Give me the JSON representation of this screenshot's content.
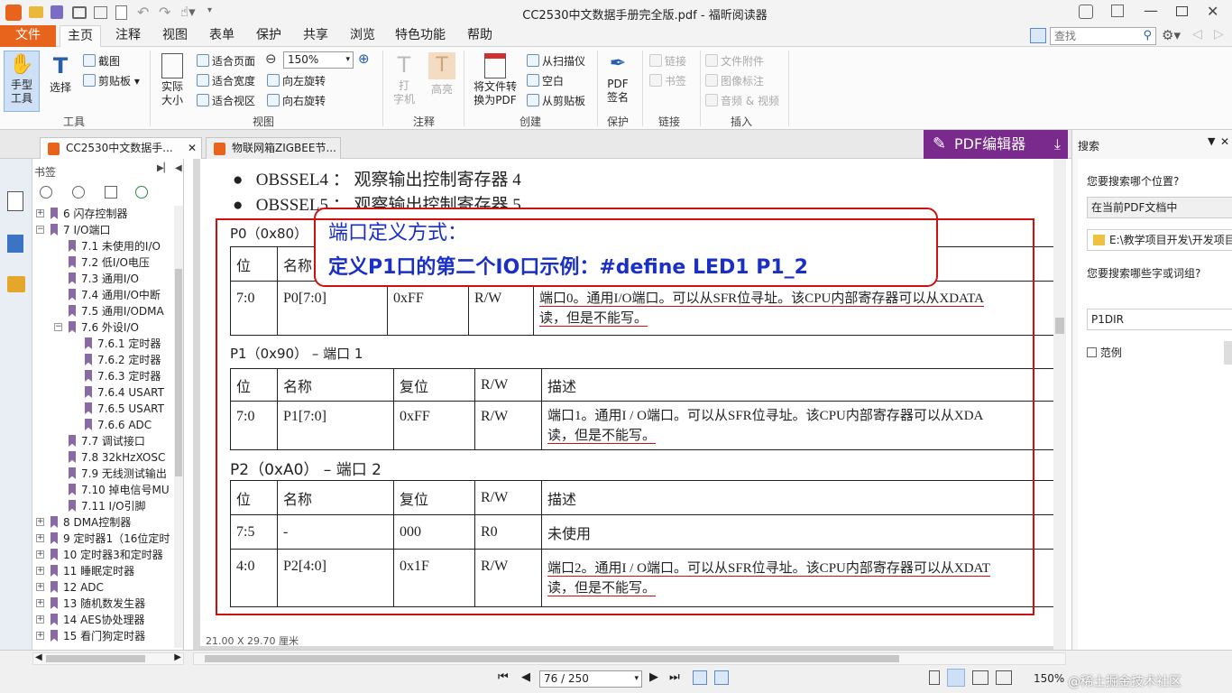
{
  "window": {
    "title": "CC2530中文数据手册完全版.pdf - 福昕阅读器"
  },
  "ribbon_tabs": [
    "文件",
    "主页",
    "注释",
    "视图",
    "表单",
    "保护",
    "共享",
    "浏览",
    "特色功能",
    "帮助"
  ],
  "search_box": {
    "placeholder": "查找"
  },
  "ribbon": {
    "tools": {
      "hand": "手型\n工具",
      "select": "选择",
      "snapshot": "截图",
      "clipboard": "剪贴板",
      "label": "工具"
    },
    "view": {
      "actual": "实际\n大小",
      "fit_page": "适合页面",
      "fit_width": "适合宽度",
      "fit_visible": "适合视区",
      "zoom": "150%",
      "rotate_left": "向左旋转",
      "rotate_right": "向右旋转",
      "label": "视图"
    },
    "comment": {
      "typewriter": "打\n字机",
      "highlight": "高亮",
      "label": "注释"
    },
    "create": {
      "convert": "将文件转\n换为PDF",
      "scanner": "从扫描仪",
      "blank": "空白",
      "from_clipboard": "从剪贴板",
      "label": "创建"
    },
    "protect": {
      "sign": "PDF\n签名",
      "label": "保护"
    },
    "links": {
      "link": "链接",
      "bookmark": "书签",
      "label": "链接"
    },
    "insert": {
      "attachment": "文件附件",
      "image": "图像标注",
      "av": "音频 & 视频",
      "label": "插入"
    }
  },
  "doc_tabs": [
    "CC2530中文数据手...",
    "物联网箱ZIGBEE节..."
  ],
  "pdf_editor": "PDF编辑器",
  "bookmarks": {
    "title": "书签",
    "items": [
      {
        "text": "6  闪存控制器",
        "level": 0,
        "tw": "+"
      },
      {
        "text": "7  I/O端口",
        "level": 0,
        "tw": "-"
      },
      {
        "text": "7.1  未使用的I/O",
        "level": 1
      },
      {
        "text": "7.2  低I/O电压",
        "level": 1
      },
      {
        "text": "7.3  通用I/O",
        "level": 1
      },
      {
        "text": "7.4  通用I/O中断",
        "level": 1
      },
      {
        "text": "7.5  通用I/ODMA",
        "level": 1
      },
      {
        "text": "7.6  外设I/O",
        "level": 1,
        "tw": "-"
      },
      {
        "text": "7.6.1  定时器",
        "level": 2
      },
      {
        "text": "7.6.2  定时器",
        "level": 2
      },
      {
        "text": "7.6.3  定时器",
        "level": 2
      },
      {
        "text": "7.6.4  USART",
        "level": 2
      },
      {
        "text": "7.6.5  USART",
        "level": 2
      },
      {
        "text": "7.6.6  ADC",
        "level": 2
      },
      {
        "text": "7.7  调试接口",
        "level": 1
      },
      {
        "text": "7.8  32kHzXOSC",
        "level": 1
      },
      {
        "text": "7.9  无线测试输出",
        "level": 1
      },
      {
        "text": "7.10  掉电信号MU",
        "level": 1
      },
      {
        "text": "7.11  I/O引脚",
        "level": 1
      },
      {
        "text": "8  DMA控制器",
        "level": 0,
        "tw": "+"
      },
      {
        "text": "9  定时器1（16位定时",
        "level": 0,
        "tw": "+"
      },
      {
        "text": "10  定时器3和定时器",
        "level": 0,
        "tw": "+"
      },
      {
        "text": "11  睡眠定时器",
        "level": 0,
        "tw": "+"
      },
      {
        "text": "12  ADC",
        "level": 0,
        "tw": "+"
      },
      {
        "text": "13  随机数发生器",
        "level": 0,
        "tw": "+"
      },
      {
        "text": "14  AES协处理器",
        "level": 0,
        "tw": "+"
      },
      {
        "text": "15  看门狗定时器",
        "level": 0,
        "tw": "+"
      }
    ]
  },
  "doc": {
    "line1": "OBSSEL4 ： 观察输出控制寄存器 4",
    "line2": "OBSSEL5 ： 观察输出控制寄存器 5",
    "callout1": "端口定义方式：",
    "callout2": "定义P1口的第二个IO口示例：#define LED1 P1_2",
    "p0_title": "P0（0x80）",
    "p1_title": "P1（0x90） – 端口 1",
    "p2_title": "P2（0xA0） – 端口 2",
    "hdr": [
      "位",
      "名称",
      "复位",
      "R/W",
      "描述"
    ],
    "p0_row": [
      "7:0",
      "P0[7:0]",
      "0xFF",
      "R/W",
      "端口0。通用I/O端口。可以从SFR位寻址。该CPU内部寄存器可以从XDATA",
      "读，但是不能写。"
    ],
    "p1_row": [
      "7:0",
      "P1[7:0]",
      "0xFF",
      "R/W",
      "端口1。通用I / O端口。可以从SFR位寻址。该CPU内部寄存器可以从XDA",
      "读，但是不能写。"
    ],
    "p2_row1": [
      "7:5",
      "-",
      "000",
      "R0",
      "未使用"
    ],
    "p2_row2": [
      "4:0",
      "P2[4:0]",
      "0x1F",
      "R/W",
      "端口2。通用I / O端口。可以从SFR位寻址。该CPU内部寄存器可以从XDAT",
      "读，但是不能写。"
    ],
    "page_size": "21.00 X 29.70 厘米"
  },
  "search_panel": {
    "title": "搜索",
    "where_label": "您要搜索哪个位置?",
    "where_value": "在当前PDF文档中",
    "path": "E:\\教学项目开发\\开发项目",
    "what_label": "您要搜索哪些字或词组?",
    "query": "P1DIR",
    "whole_word": "范例"
  },
  "status": {
    "page": "76 / 250",
    "zoom": "150%"
  },
  "watermark": "@稀土掘金技术社区"
}
